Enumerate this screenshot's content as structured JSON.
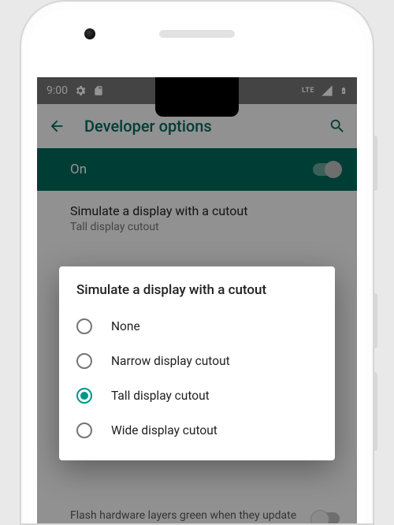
{
  "statusbar": {
    "time": "9:00",
    "network_label": "LTE"
  },
  "appbar": {
    "title": "Developer options"
  },
  "master_switch": {
    "label": "On",
    "enabled": true
  },
  "current_setting": {
    "title": "Simulate a display with a cutout",
    "value": "Tall display cutout"
  },
  "dialog": {
    "title": "Simulate a display with a cutout",
    "options": [
      {
        "label": "None",
        "selected": false
      },
      {
        "label": "Narrow display cutout",
        "selected": false
      },
      {
        "label": "Tall display cutout",
        "selected": true
      },
      {
        "label": "Wide display cutout",
        "selected": false
      }
    ]
  },
  "background_row": {
    "title": "Flash hardware layers green when they update"
  },
  "colors": {
    "accent": "#00695c",
    "radio_accent": "#009688"
  }
}
